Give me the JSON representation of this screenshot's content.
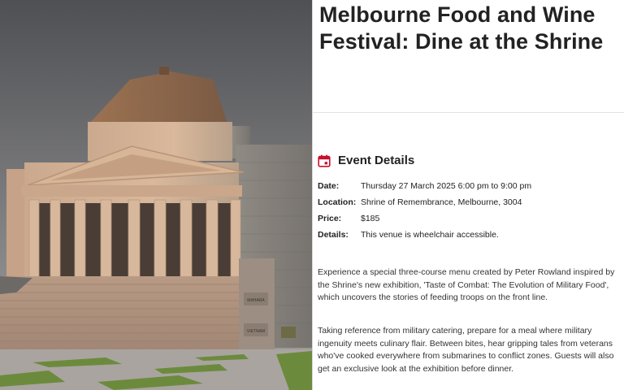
{
  "hero": {
    "image": "shrine-of-remembrance-photo",
    "inscription_1": "MAHARA",
    "inscription_2": "VIETNAM"
  },
  "article": {
    "title_line1": "Melbourne Food and Wine",
    "title_line2": "Festival: Dine at the Shrine"
  },
  "event_details": {
    "heading": "Event Details",
    "icon": "calendar-icon",
    "accent_color": "#c8102e",
    "rows": [
      {
        "label": "Date:",
        "value": "Thursday 27 March 2025 6:00 pm to 9:00 pm"
      },
      {
        "label": "Location:",
        "value": "Shrine of Remembrance, Melbourne, 3004"
      },
      {
        "label": "Price:",
        "value": "$185"
      },
      {
        "label": "Details:",
        "value": "This venue is wheelchair accessible."
      }
    ]
  },
  "description": {
    "paragraph_1": "Experience a special three-course menu created by Peter Rowland inspired by the Shrine's new exhibition, 'Taste of Combat: The Evolution of Military Food', which uncovers the stories of feeding troops on the front line.",
    "paragraph_2": "Taking reference from military catering, prepare for a meal where military ingenuity meets culinary flair. Between bites, hear gripping tales from veterans who've cooked everywhere from submarines to conflict zones. Guests will also get an exclusive look at the exhibition before dinner."
  }
}
